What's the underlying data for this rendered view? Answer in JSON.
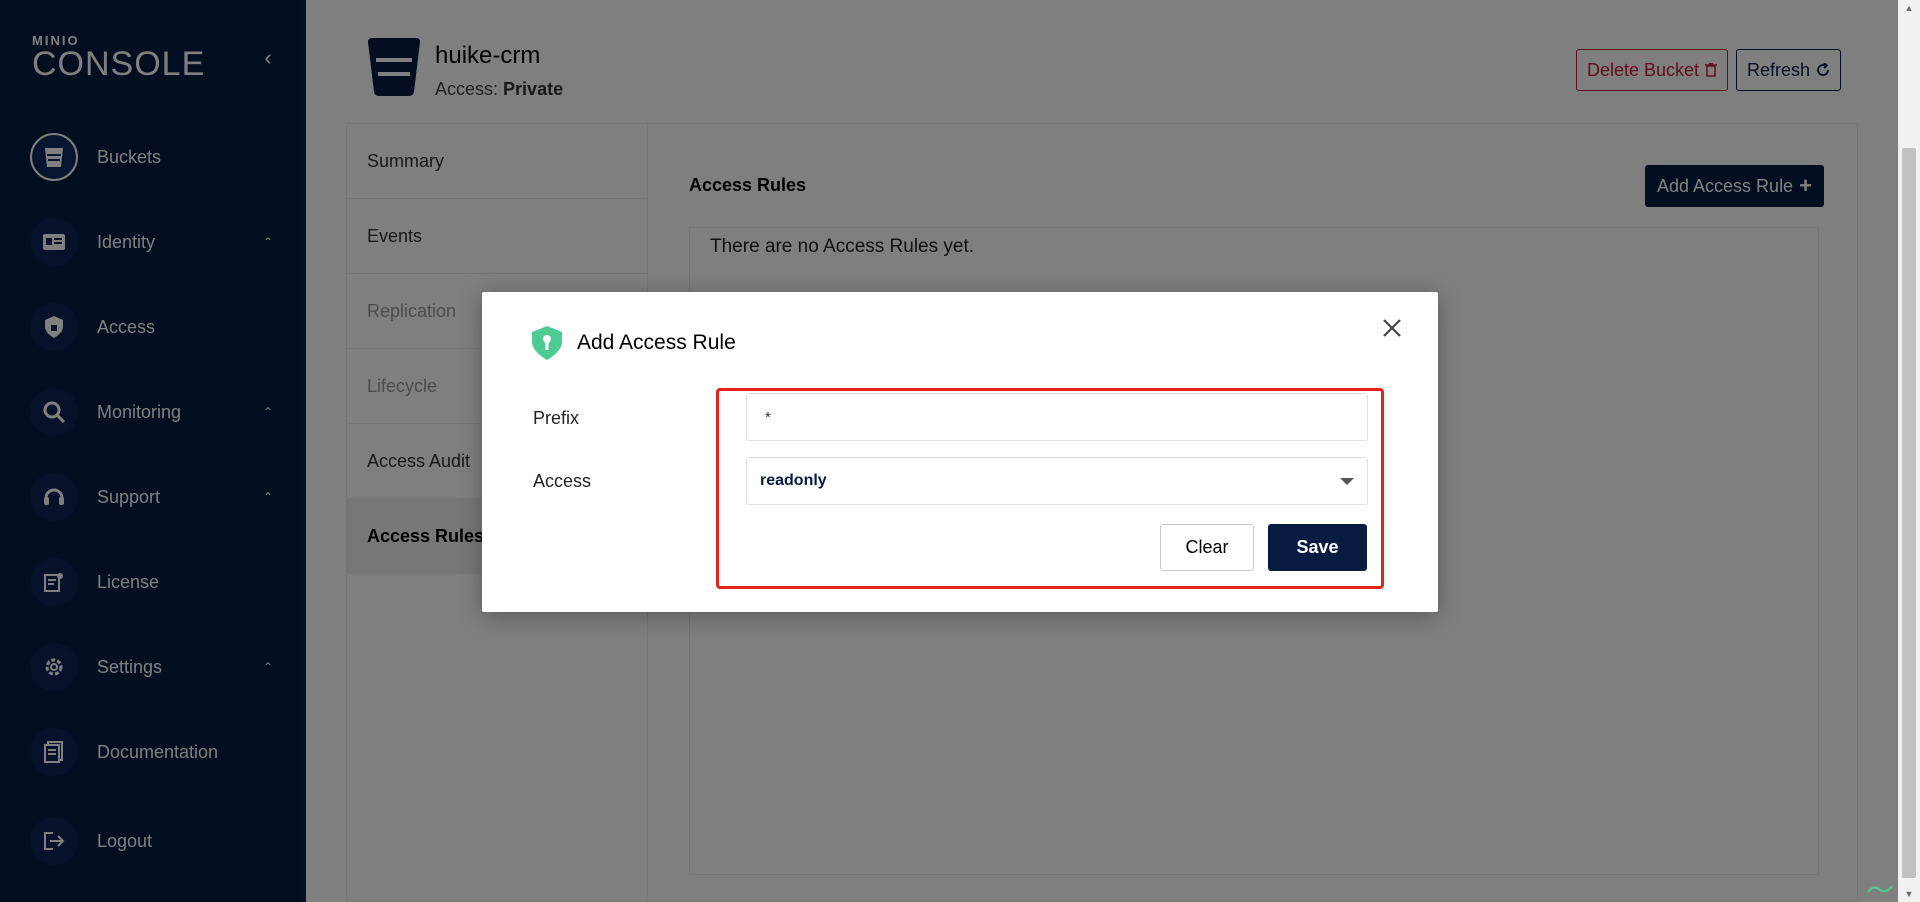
{
  "sidebar": {
    "logo_top": "MINIO",
    "logo_bottom": "CONSOLE",
    "collapse_icon": "chevron-left",
    "items": [
      {
        "label": "Buckets",
        "icon": "bucket-icon",
        "active": true
      },
      {
        "label": "Identity",
        "icon": "id-card-icon",
        "expandable": true
      },
      {
        "label": "Access",
        "icon": "lock-shield-icon"
      },
      {
        "label": "Monitoring",
        "icon": "magnifier-chart-icon",
        "expandable": true
      },
      {
        "label": "Support",
        "icon": "headset-icon",
        "expandable": true
      },
      {
        "label": "License",
        "icon": "license-icon"
      },
      {
        "label": "Settings",
        "icon": "gear-icon",
        "expandable": true
      },
      {
        "label": "Documentation",
        "icon": "document-icon"
      },
      {
        "label": "Logout",
        "icon": "logout-icon"
      }
    ]
  },
  "header": {
    "bucket_name": "huike-crm",
    "access_label": "Access:",
    "access_value": "Private",
    "delete_label": "Delete Bucket",
    "refresh_label": "Refresh"
  },
  "tabs": [
    {
      "label": "Summary"
    },
    {
      "label": "Events"
    },
    {
      "label": "Replication",
      "disabled": true
    },
    {
      "label": "Lifecycle",
      "disabled": true
    },
    {
      "label": "Access Audit"
    },
    {
      "label": "Access Rules",
      "active": true
    }
  ],
  "access_rules": {
    "title": "Access Rules",
    "add_label": "Add Access Rule",
    "empty_text": "There are no Access Rules yet."
  },
  "modal": {
    "title": "Add Access Rule",
    "prefix_label": "Prefix",
    "prefix_value": "*",
    "access_label": "Access",
    "access_value": "readonly",
    "clear_label": "Clear",
    "save_label": "Save"
  },
  "colors": {
    "sidebar_bg": "#081c42",
    "primary": "#081c42",
    "danger": "#c51b3f",
    "shield": "#4ccb92",
    "highlight": "#e4231b"
  }
}
